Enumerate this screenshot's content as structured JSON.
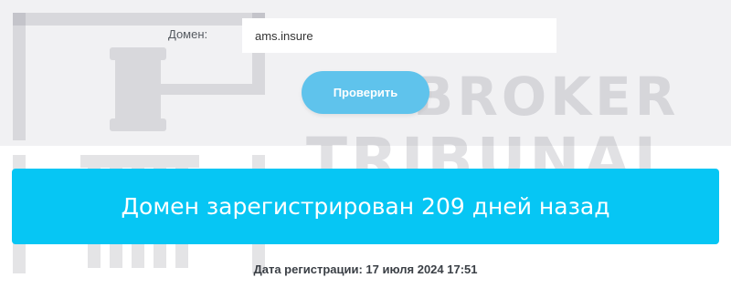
{
  "form": {
    "domain_label": "Домен:",
    "domain_value": "ams.insure",
    "check_button_label": "Проверить"
  },
  "result": {
    "message": "Домен зарегистрирован 209 дней назад"
  },
  "registration": {
    "text": "Дата регистрации: 17 июля 2024 17:51"
  },
  "watermark": {
    "line1": "BROKER",
    "line2": "TRIBUNAL",
    "icon": "gavel-icon"
  },
  "colors": {
    "accent": "#06c6f4",
    "button": "#5fc3ec",
    "panel": "#f1f1f3"
  }
}
